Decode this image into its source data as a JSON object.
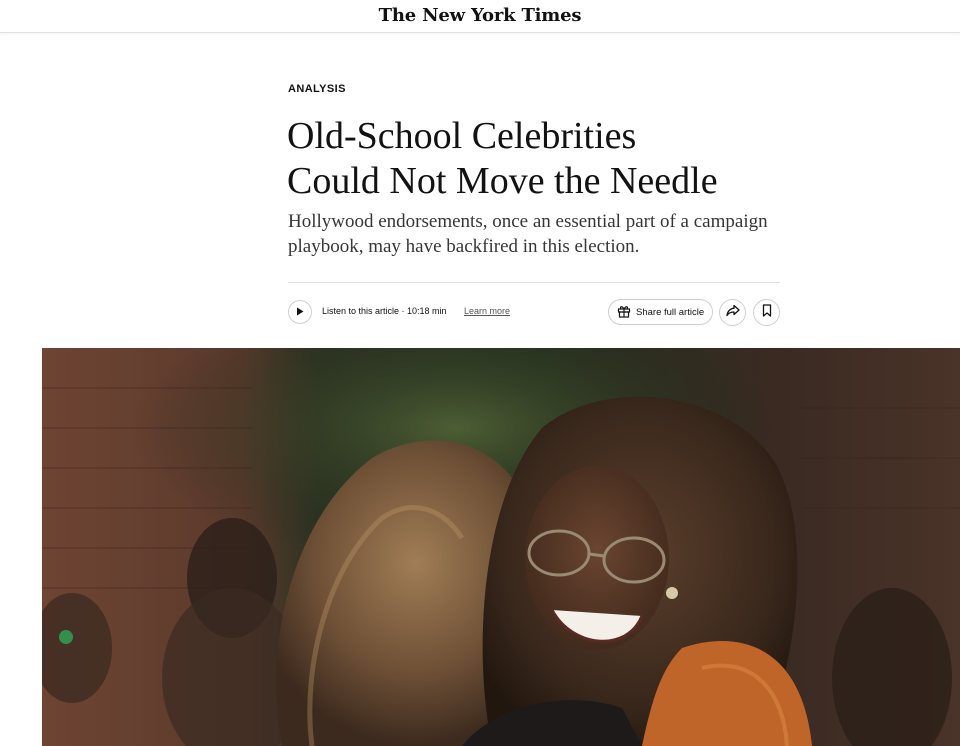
{
  "masthead": {
    "logo_text": "The New York Times",
    "logo_icon": "nyt-wordmark"
  },
  "article": {
    "kicker": "ANALYSIS",
    "headline_line1": "Old-School Celebrities",
    "headline_line2": "Could Not Move the Needle",
    "summary": "Hollywood endorsements, once an essential part of a campaign playbook, may have backfired in this election."
  },
  "toolbar": {
    "listen_label": "Listen to this article · 10:18 min",
    "learn_more_label": "Learn more",
    "share_label": "Share full article",
    "icons": {
      "play": "play-icon",
      "gift": "gift-icon",
      "forward": "forward-share-icon",
      "bookmark": "bookmark-icon"
    }
  },
  "hero": {
    "image_description_icon": "photo",
    "colors": {
      "brick": "#7a4a37",
      "foliage": "#3c4a2e",
      "hair_light": "#8a6a4a",
      "hair_dark": "#3b2a1f",
      "jacket": "#c0652a"
    }
  }
}
